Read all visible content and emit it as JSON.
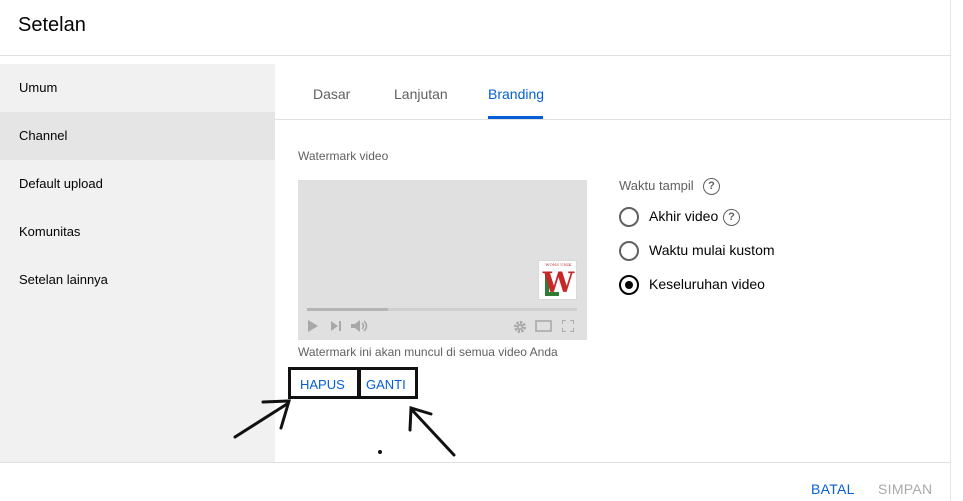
{
  "dialog": {
    "title": "Setelan"
  },
  "sidebar": {
    "items": [
      {
        "label": "Umum"
      },
      {
        "label": "Channel"
      },
      {
        "label": "Default upload"
      },
      {
        "label": "Komunitas"
      },
      {
        "label": "Setelan lainnya"
      }
    ],
    "active_index": 1
  },
  "tabs": [
    {
      "label": "Dasar"
    },
    {
      "label": "Lanjutan"
    },
    {
      "label": "Branding"
    }
  ],
  "active_tab": "Branding",
  "branding": {
    "section_label": "Watermark video",
    "watermark_preview": {
      "brand_text": "WONS UNIK",
      "letter": "W"
    },
    "player_progress": 0.3,
    "helper_text": "Watermark ini akan muncul di semua video Anda",
    "remove_label": "HAPUS",
    "replace_label": "GANTI",
    "display_time": {
      "heading": "Waktu tampil",
      "options": [
        {
          "label": "Akhir video",
          "checked": false
        },
        {
          "label": "Waktu mulai kustom",
          "checked": false
        },
        {
          "label": "Keseluruhan video",
          "checked": true
        }
      ]
    }
  },
  "footer": {
    "cancel_label": "BATAL",
    "save_label": "SIMPAN"
  },
  "colors": {
    "accent": "#065fd4",
    "annotation": "#111111",
    "sidebar_bg": "#f1f1f1",
    "sidebar_active": "#e5e5e5"
  },
  "icons": [
    "help-icon",
    "play-icon",
    "next-icon",
    "volume-icon",
    "gear-icon",
    "theater-icon",
    "fullscreen-icon",
    "arrow-annotation-icon"
  ]
}
